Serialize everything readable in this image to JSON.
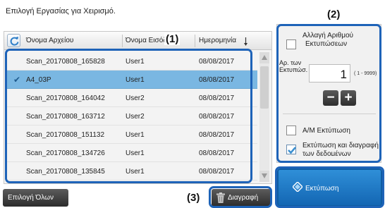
{
  "header": {
    "title": "Επιλογή Εργασίας για Χειρισμό."
  },
  "list": {
    "columns": {
      "file_name": "Όνομα Αρχείου",
      "user_name": "Όνομα Εισόδ",
      "date": "Ημερομηνία"
    },
    "rows": [
      {
        "file_name": "Scan_20170808_165828",
        "user": "User1",
        "date": "08/08/2017",
        "selected": false
      },
      {
        "file_name": "A4_03P",
        "user": "User1",
        "date": "08/08/2017",
        "selected": true
      },
      {
        "file_name": "Scan_20170808_164042",
        "user": "User2",
        "date": "08/08/2017",
        "selected": false
      },
      {
        "file_name": "Scan_20170808_163712",
        "user": "User2",
        "date": "08/08/2017",
        "selected": false
      },
      {
        "file_name": "Scan_20170808_151132",
        "user": "User1",
        "date": "08/08/2017",
        "selected": false
      },
      {
        "file_name": "Scan_20170808_134726",
        "user": "User1",
        "date": "08/08/2017",
        "selected": false
      },
      {
        "file_name": "Scan_20170808_135845",
        "user": "User1",
        "date": "08/08/2017",
        "selected": false
      }
    ]
  },
  "settings": {
    "change_copies_label_1": "Αλλαγή Αριθμού",
    "change_copies_label_2": "Εκτυπώσεων",
    "change_copies_checked": false,
    "copies_label_1": "Αρ. των",
    "copies_label_2": "Εκτυπώσ.",
    "copies_value": "1",
    "copies_range": "( 1 - 9999)",
    "minus_label": "−",
    "plus_label": "+",
    "bw_print_label": "Α/Μ Εκτύπωση",
    "bw_print_checked": false,
    "print_delete_label_1": "Εκτύπωση και διαγραφή",
    "print_delete_label_2": "των δεδομένων",
    "print_delete_checked": true
  },
  "buttons": {
    "select_all": "Επιλογή Όλων",
    "delete": "Διαγραφή",
    "print": "Εκτύπωση"
  },
  "callouts": {
    "one": "(1)",
    "two": "(2)",
    "three": "(3)"
  },
  "colors": {
    "highlight": "#1e63b8",
    "selected_row": "#7ab7e2",
    "print_button": "#1a73c2"
  }
}
